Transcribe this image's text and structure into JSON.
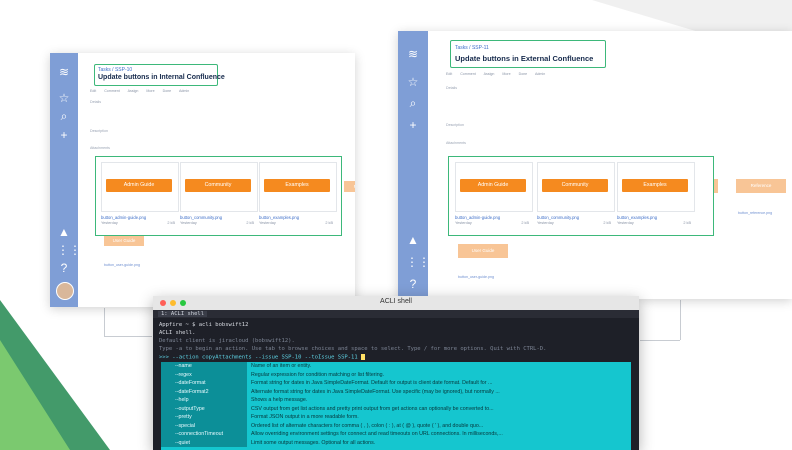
{
  "windows": [
    {
      "breadcrumb": "Tasks / SSP-10",
      "title": "Update buttons in Internal Confluence",
      "toolbar": [
        "Edit",
        "Comment",
        "Assign",
        "More",
        "Done",
        "Admin"
      ],
      "sections": [
        "Details",
        "Description",
        "Attachments"
      ],
      "attachments": [
        {
          "button": "Admin Guide",
          "file": "button_admin-guide.png",
          "when": "Yesterday",
          "size": "2 kB"
        },
        {
          "button": "Community",
          "file": "button_community.png",
          "when": "Yesterday",
          "size": "2 kB"
        },
        {
          "button": "Examples",
          "file": "button_examples.png",
          "when": "Yesterday",
          "size": "2 kB"
        }
      ],
      "ghost_buttons": [
        "Reference",
        "User Guide"
      ],
      "ghost_file": "button_user-guide.png"
    },
    {
      "breadcrumb": "Tasks / SSP-11",
      "title": "Update buttons in External Confluence",
      "toolbar": [
        "Edit",
        "Comment",
        "Assign",
        "More",
        "Done",
        "Admin"
      ],
      "sections": [
        "Details",
        "Description",
        "Attachments"
      ],
      "attachments": [
        {
          "button": "Admin Guide",
          "file": "button_admin-guide.png",
          "when": "Yesterday",
          "size": "2 kB"
        },
        {
          "button": "Community",
          "file": "button_community.png",
          "when": "Yesterday",
          "size": "2 kB"
        },
        {
          "button": "Examples",
          "file": "button_examples.png",
          "when": "Yesterday",
          "size": "2 kB"
        }
      ],
      "ghost_buttons": [
        "How To",
        "Reference",
        "User Guide"
      ],
      "ghost_files": [
        "button_reference.png",
        "button_user-guide.png"
      ]
    }
  ],
  "terminal": {
    "window_title": "ACLI shell",
    "tab": "1: ACLI shell",
    "lines": {
      "prompt": "Appfire ~ $ acli bobswift12",
      "banner": "ACLI shell.",
      "default_client": "Default client is jiracloud (bobswift12).",
      "help": "Type -a to begin an action. Use tab to browse choices and space to select. Type / for more options. Quit with CTRL-D.",
      "command": ">>> --action copyAttachments --issue SSP-10 --toIssue SSP-11 "
    },
    "suggestions": [
      {
        "option": "--name",
        "desc": "Name of an item or entity."
      },
      {
        "option": "--regex",
        "desc": "Regular expression for condition matching or list filtering."
      },
      {
        "option": "--dateFormat",
        "desc": "Format string for dates in Java SimpleDateFormat. Default for output is client date format. Default for ..."
      },
      {
        "option": "--dateFormat2",
        "desc": "Alternate format string for dates in Java SimpleDateFormat. Use specific (may be ignored), but normally ..."
      },
      {
        "option": "--help",
        "desc": "Shows a help message."
      },
      {
        "option": "--outputType",
        "desc": "CSV output from get list actions and pretty print output from get actions can optionally be converted to..."
      },
      {
        "option": "--pretty",
        "desc": "Format JSON output in a more readable form."
      },
      {
        "option": "--special",
        "desc": "Ordered list of alternate characters for comma ( , ), colon ( : ), at ( @ ), quote ( ' ), and double quo..."
      },
      {
        "option": "--connectionTimeout",
        "desc": "Allow overriding environment settings for connect and read timeouts on URL connections. In milliseconds,..."
      },
      {
        "option": "--quiet",
        "desc": "Limit some output messages. Optional for all actions."
      }
    ]
  }
}
